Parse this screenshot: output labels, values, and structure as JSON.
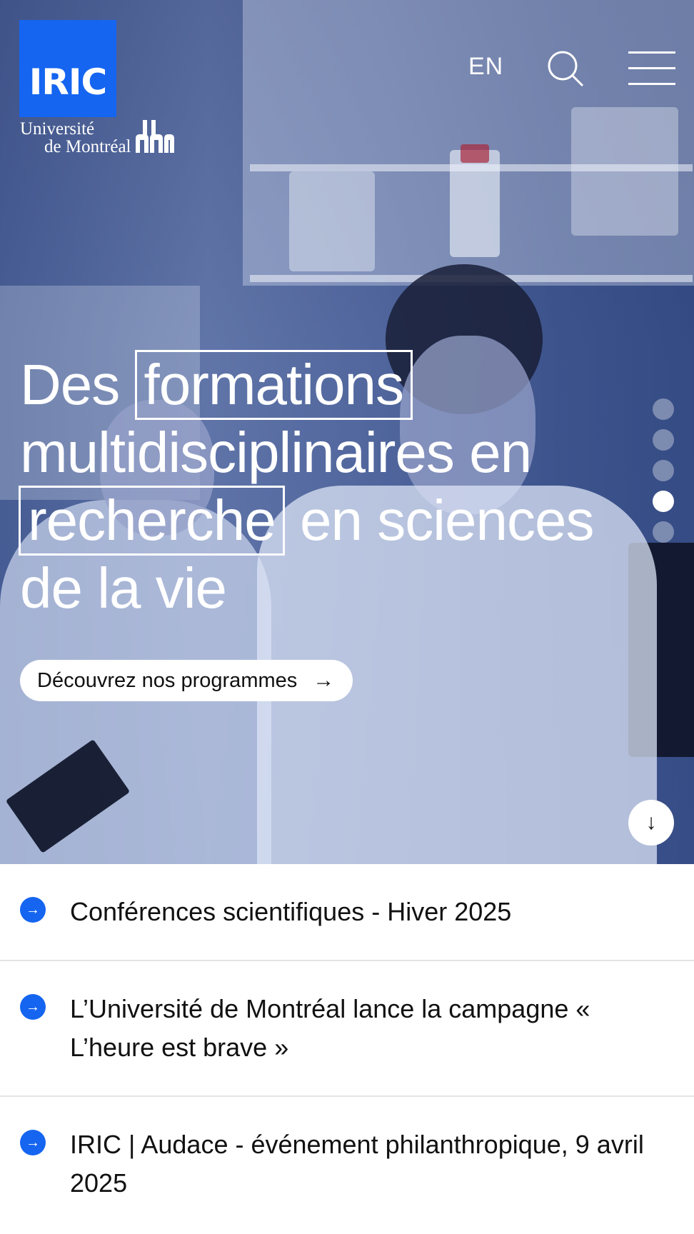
{
  "header": {
    "logo_text": "IRIC",
    "university_line1": "Université",
    "university_line2": "de Montréal",
    "lang_label": "EN",
    "search_icon": "search-icon",
    "menu_icon": "hamburger-menu-icon"
  },
  "hero": {
    "headline_word1": "Des",
    "headline_boxed1": "formations",
    "headline_line2": "multidisciplinaires en",
    "headline_boxed2": "recherche",
    "headline_line3_rest": "en sciences",
    "headline_line4": "de la vie",
    "cta_label": "Découvrez nos programmes",
    "cta_arrow": "→",
    "scroll_arrow": "↓",
    "slides_total": 5,
    "active_slide": 4
  },
  "news": {
    "items": [
      {
        "title": "Conférences scientifiques - Hiver 2025"
      },
      {
        "title": "L’Université de Montréal lance la campagne « L’heure est brave »"
      },
      {
        "title": "IRIC | Audace - événement philanthropique, 9 avril 2025"
      }
    ],
    "item_icon": "→"
  },
  "colors": {
    "brand_blue": "#1565f0",
    "hero_overlay": "#3c5590",
    "divider": "#e2e4e8"
  }
}
